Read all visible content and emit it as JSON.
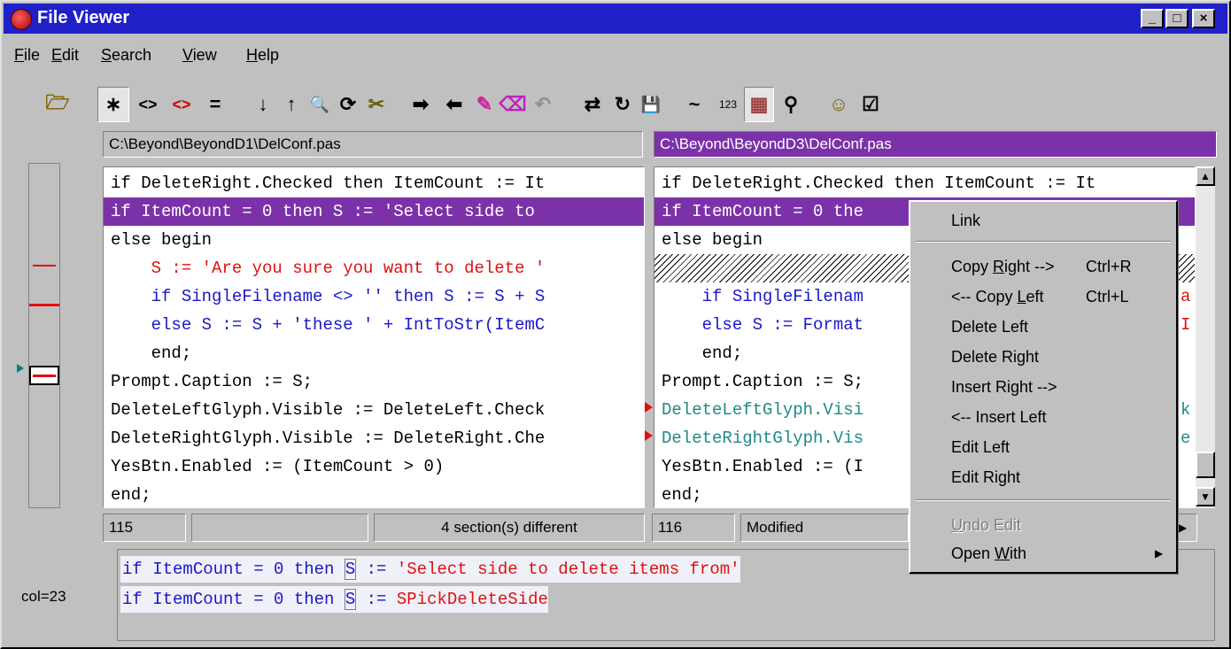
{
  "window": {
    "title": "File Viewer"
  },
  "caption_buttons": {
    "minimize": "_",
    "maximize": "□",
    "close": "×"
  },
  "menubar": [
    {
      "pre": "",
      "key": "F",
      "post": "ile"
    },
    {
      "pre": "",
      "key": "E",
      "post": "dit"
    },
    {
      "pre": "",
      "key": "S",
      "post": "earch"
    },
    {
      "pre": "",
      "key": "V",
      "post": "iew"
    },
    {
      "pre": "",
      "key": "H",
      "post": "elp"
    }
  ],
  "toolbar": {
    "open": "🗁",
    "all": "∗",
    "diff": "<>",
    "diff_red": "<>",
    "same": "=",
    "next": "↓",
    "prev": "↑",
    "find": "🔍",
    "replace": "⟳",
    "scissors": "✂",
    "copy_right": "➡",
    "copy_left": "⬅",
    "edit": "✎",
    "erase": "⌫",
    "undo": "↶",
    "swap": "⇄",
    "refresh": "↻",
    "save": "💾",
    "tilde": "~",
    "num": "123",
    "toggle": "▦",
    "zoom": "⚲",
    "person": "☺",
    "checklist": "☑"
  },
  "paths": {
    "left": "C:\\Beyond\\BeyondD1\\DelConf.pas",
    "right": "C:\\Beyond\\BeyondD3\\DelConf.pas"
  },
  "left_lines": [
    "if DeleteRight.Checked then ItemCount := It",
    "if ItemCount = 0 then S := 'Select side to",
    "else begin",
    "    S := 'Are you sure you want to delete '",
    "    if SingleFilename <> '' then S := S + S",
    "    else S := S + 'these ' + IntToStr(ItemC",
    "    end;",
    "Prompt.Caption := S;",
    "DeleteLeftGlyph.Visible := DeleteLeft.Check",
    "DeleteRightGlyph.Visible := DeleteRight.Che",
    "YesBtn.Enabled := (ItemCount > 0)",
    "end;"
  ],
  "right_lines": [
    "if DeleteRight.Checked then ItemCount := It",
    "if ItemCount = 0 the",
    "else begin",
    "",
    "    if SingleFilenam",
    "    else S := Format",
    "    end;",
    "Prompt.Caption := S;",
    "DeleteLeftGlyph.Visi",
    "DeleteRightGlyph.Vis",
    "YesBtn.Enabled := (I",
    "end;"
  ],
  "right_tail": {
    "line5": "a",
    "line6": "I",
    "line9": "k",
    "line10": "e"
  },
  "status": {
    "left_line": "115",
    "left_blank": "",
    "diff_summary": "4 section(s) different",
    "right_line": "116",
    "right_state": "Modified"
  },
  "bottom": {
    "col": "col=23",
    "line1_a": "if ItemCount = 0 then ",
    "line1_b": "S",
    "line1_c": " := ",
    "line1_d": "'Select side to delete items from'",
    "line2_a": "if ItemCount = 0 then ",
    "line2_b": "S",
    "line2_c": " := ",
    "line2_d": "SPickDeleteSide"
  },
  "context_menu": {
    "link": "Link",
    "copy_right_pre": "Copy ",
    "copy_right_key": "R",
    "copy_right_post": "ight -->",
    "copy_right_sc": "Ctrl+R",
    "copy_left_pre": "<-- Copy ",
    "copy_left_key": "L",
    "copy_left_post": "eft",
    "copy_left_sc": "Ctrl+L",
    "delete_left": "Delete Left",
    "delete_right": "Delete Right",
    "insert_right": "Insert Right -->",
    "insert_left": "<-- Insert Left",
    "edit_left": "Edit Left",
    "edit_right": "Edit Right",
    "undo_key": "U",
    "undo_post": "ndo Edit",
    "open_pre": "Open ",
    "open_key": "W",
    "open_post": "ith",
    "submenu_arrow": "▶"
  },
  "colors": {
    "title": "#2020c8",
    "selection": "#7b32a8",
    "red": "#e01010",
    "blue": "#1818c8",
    "teal": "#208888"
  }
}
